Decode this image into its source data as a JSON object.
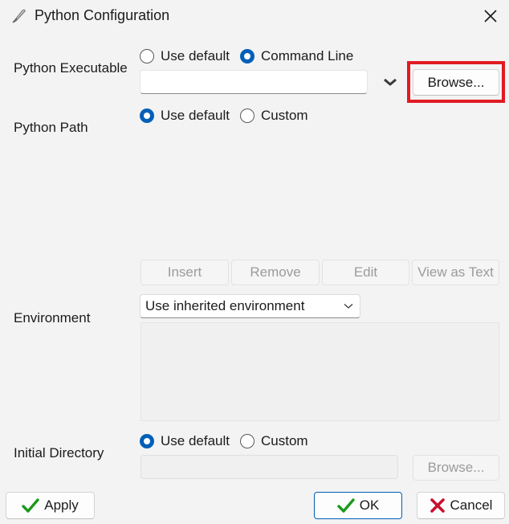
{
  "window": {
    "title": "Python Configuration",
    "title_icon": "feather-pen-icon",
    "close_icon": "close-icon"
  },
  "python_executable": {
    "label": "Python Executable",
    "option_default": "Use default",
    "option_command_line": "Command Line",
    "selected": "command_line",
    "value": "",
    "dropdown_icon": "chevron-down-icon",
    "browse_label": "Browse..."
  },
  "python_path": {
    "label": "Python Path",
    "option_default": "Use default",
    "option_custom": "Custom",
    "selected": "default",
    "buttons": {
      "insert": "Insert",
      "remove": "Remove",
      "edit": "Edit",
      "view_as_text": "View as Text"
    }
  },
  "environment": {
    "label": "Environment",
    "selected_option": "Use inherited environment"
  },
  "initial_directory": {
    "label": "Initial Directory",
    "option_default": "Use default",
    "option_custom": "Custom",
    "selected": "default",
    "value": "",
    "browse_label": "Browse..."
  },
  "footer": {
    "apply": "Apply",
    "ok": "OK",
    "cancel": "Cancel"
  },
  "colors": {
    "accent": "#005fb8",
    "highlight": "#e11b22",
    "check": "#1a9a1a",
    "cancel_x": "#c8102e"
  }
}
